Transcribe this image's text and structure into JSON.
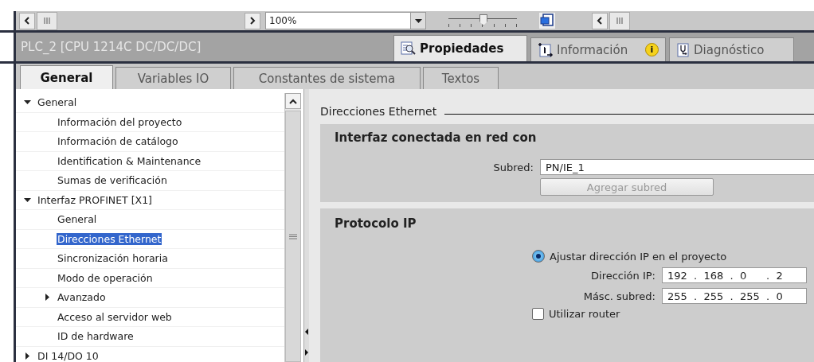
{
  "toolbar": {
    "zoom": "100%",
    "zoom_slider": {
      "level": 0.5
    }
  },
  "title": "PLC_2 [CPU 1214C DC/DC/DC]",
  "inspector_tabs": [
    {
      "label": "Propiedades",
      "selected": true,
      "kind": "properties"
    },
    {
      "label": "Información",
      "selected": false,
      "kind": "info",
      "badge": "i"
    },
    {
      "label": "Diagnóstico",
      "selected": false,
      "kind": "diagnostics"
    }
  ],
  "tabs": [
    {
      "label": "General",
      "selected": true
    },
    {
      "label": "Variables IO",
      "selected": false
    },
    {
      "label": "Constantes de sistema",
      "selected": false
    },
    {
      "label": "Textos",
      "selected": false
    }
  ],
  "tree": [
    {
      "label": "General",
      "selected": false,
      "expanded": true,
      "children": [
        {
          "label": "Información del proyecto",
          "selected": false
        },
        {
          "label": "Información de catálogo",
          "selected": false
        },
        {
          "label": "Identification & Maintenance",
          "selected": false
        },
        {
          "label": "Sumas de verificación",
          "selected": false
        }
      ]
    },
    {
      "label": "Interfaz PROFINET [X1]",
      "selected": false,
      "expanded": true,
      "children": [
        {
          "label": "General",
          "selected": false
        },
        {
          "label": "Direcciones Ethernet",
          "selected": true
        },
        {
          "label": "Sincronización horaria",
          "selected": false
        },
        {
          "label": "Modo de operación",
          "selected": false
        },
        {
          "label": "Avanzado",
          "selected": false,
          "expanded": false
        },
        {
          "label": "Acceso al servidor web",
          "selected": false
        },
        {
          "label": "ID de hardware",
          "selected": false
        }
      ]
    },
    {
      "label": "DI 14/DO 10",
      "selected": false,
      "expanded": false
    }
  ],
  "heading": "Direcciones Ethernet",
  "network": {
    "title": "Interfaz conectada en red con",
    "subnet_label": "Subred:",
    "subnet_value": "PN/IE_1",
    "add_button": {
      "label": "Agregar subred",
      "disabled": true
    }
  },
  "ip_protocol": {
    "title": "Protocolo IP",
    "radio": {
      "label": "Ajustar dirección IP en el proyecto",
      "selected": true
    },
    "ip_label": "Dirección IP:",
    "ip_value": "192  .  168  .  0      .  2",
    "mask_label": "Másc. subred:",
    "mask_value": "255  .  255  .  255  .  0",
    "router": {
      "label": "Utilizar router",
      "checked": false
    }
  }
}
